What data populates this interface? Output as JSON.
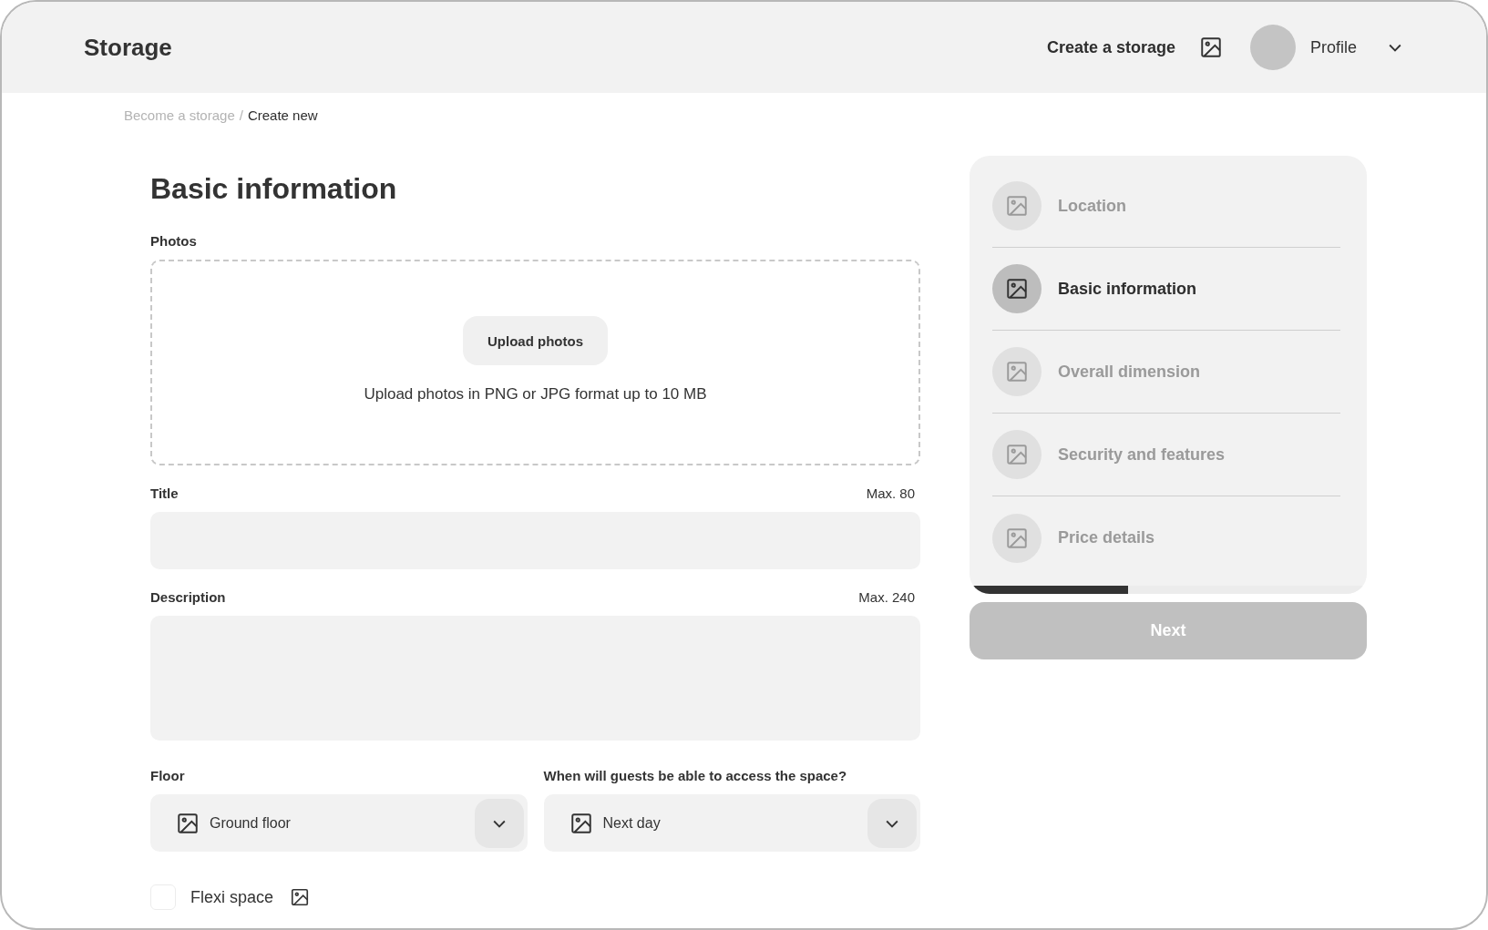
{
  "header": {
    "logo": "Storage",
    "create_link": "Create a storage",
    "profile": "Profile"
  },
  "breadcrumb": [
    {
      "label": "Become a storage",
      "current": false
    },
    {
      "separator": "/"
    },
    {
      "label": "Create new",
      "current": true
    }
  ],
  "form": {
    "heading": "Basic information",
    "photos": {
      "label": "Photos",
      "button": "Upload photos",
      "hint": "Upload photos in PNG or JPG format up to 10 MB"
    },
    "title": {
      "label": "Title",
      "limit": "Max. 80"
    },
    "description": {
      "label": "Description",
      "limit": "Max. 240"
    },
    "selects": [
      {
        "label": "Floor",
        "value": "Ground floor"
      },
      {
        "label": "When will guests be able to access the space?",
        "value": "Next day"
      }
    ],
    "flexi": {
      "label": "Flexi space",
      "checked": false
    }
  },
  "steps": [
    {
      "label": "Location",
      "selected": false
    },
    {
      "label": "Basic information",
      "selected": true
    },
    {
      "label": "Overall dimension",
      "selected": false
    },
    {
      "label": "Security and features",
      "selected": false
    },
    {
      "label": "Price details",
      "selected": false
    }
  ],
  "progress": {
    "level": 0.4
  },
  "next_button": {
    "label": "Next",
    "disabled": true
  }
}
